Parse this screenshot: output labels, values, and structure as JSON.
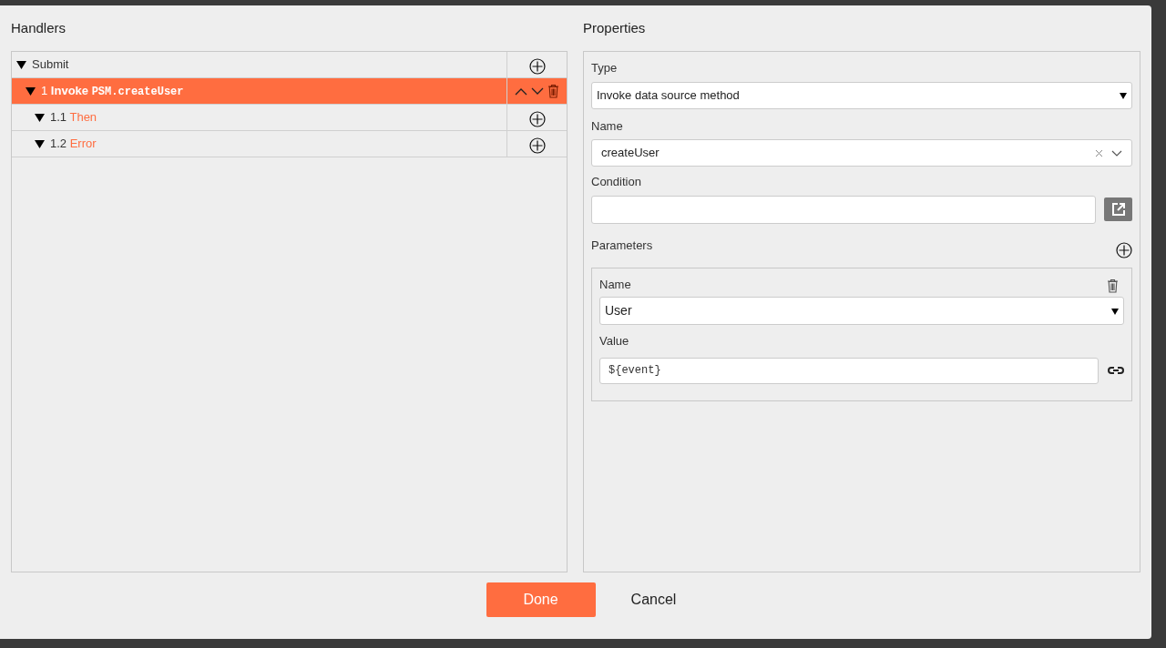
{
  "handlers": {
    "title": "Handlers",
    "tree": [
      {
        "kind": "event",
        "label": "Submit",
        "expanded": true,
        "selected": false,
        "children": [
          {
            "kind": "action",
            "number": "1",
            "label": "Invoke",
            "detail": "PSM.createUser",
            "expanded": true,
            "selected": true,
            "children": [
              {
                "kind": "branch",
                "number": "1.1",
                "label": "Then",
                "expanded": true,
                "selected": false
              },
              {
                "kind": "branch",
                "number": "1.2",
                "label": "Error",
                "expanded": true,
                "selected": false
              }
            ]
          }
        ]
      }
    ]
  },
  "properties": {
    "title": "Properties",
    "type": {
      "label": "Type",
      "value": "Invoke data source method"
    },
    "name": {
      "label": "Name",
      "value": "createUser"
    },
    "condition": {
      "label": "Condition"
    },
    "parameters": {
      "label": "Parameters",
      "items": [
        {
          "name_label": "Name",
          "name_value": "User",
          "value_label": "Value",
          "value": "${event}"
        }
      ]
    }
  },
  "buttons": {
    "done": "Done",
    "cancel": "Cancel"
  }
}
